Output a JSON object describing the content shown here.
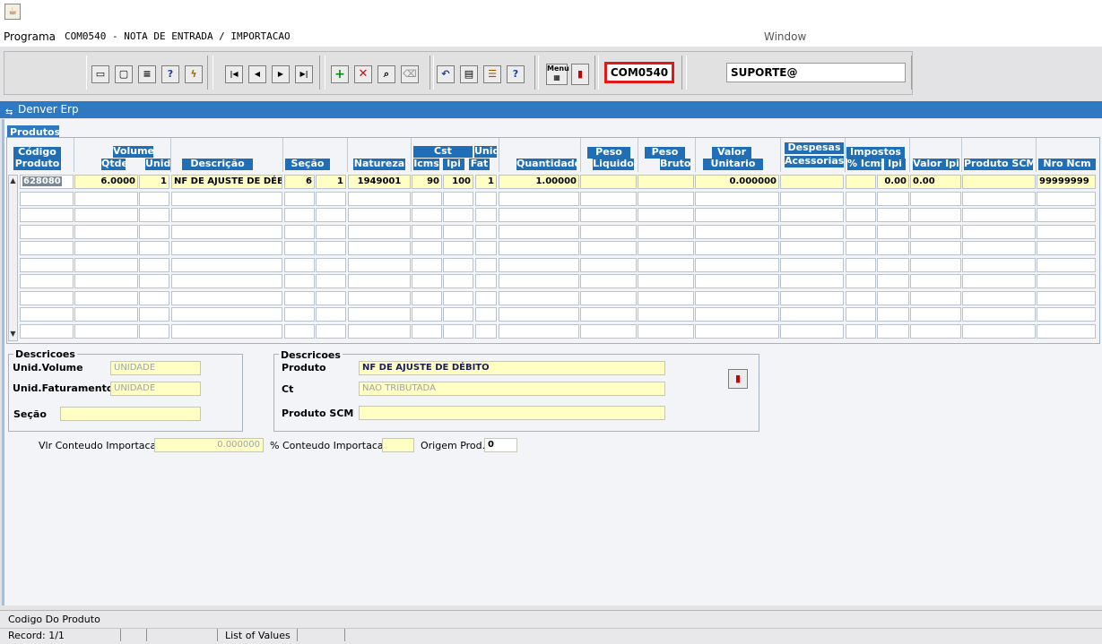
{
  "menubar": {
    "programa": "Programa",
    "form_title": "COM0540 - NOTA DE ENTRADA / IMPORTACAO",
    "window": "Window"
  },
  "toolbar": {
    "form_code": "COM0540",
    "user": "SUPORTE@",
    "icons": [
      "save-icon",
      "print-preview-icon",
      "print-icon",
      "help-query-icon",
      "execute-query-icon",
      "first-record-icon",
      "previous-record-icon",
      "next-record-icon",
      "last-record-icon",
      "insert-record-icon",
      "delete-record-icon",
      "query-icon",
      "clear-icon",
      "undo-icon",
      "copy-icon",
      "list-icon",
      "help-icon",
      "menu-icon",
      "exit-icon"
    ]
  },
  "window": {
    "title": "Denver Erp"
  },
  "tab": {
    "label": "Produtos"
  },
  "grid": {
    "headers": {
      "codigo": "Código",
      "produto": "Produto",
      "volume": "Volume",
      "qtde": "Qtde",
      "unid": "Unid.",
      "descricao": "Descrição",
      "secao": "Seção",
      "natureza": "Natureza",
      "cst": "Cst",
      "icms": "Icms",
      "ipi": "Ipi",
      "unid2": "Unid",
      "fat": "Fat",
      "quantidade": "Quantidade",
      "peso1": "Peso",
      "liquido": "Liquido",
      "peso2": "Peso",
      "bruto": "Bruto",
      "valor": "Valor",
      "unitario": "Unitario",
      "despesas": "Despesas",
      "acessorias": "Acessorias",
      "impostos": "Impostos",
      "pct_icms": "% Icms",
      "imp_ipi": "Ipi",
      "valor_ipi": "Valor Ipi",
      "produto_scm": "Produto SCM",
      "nro_ncm": "Nro Ncm"
    },
    "row1": {
      "codigo": "628080",
      "qtde": "6.0000",
      "unid": "1",
      "descricao": "NF DE AJUSTE DE DÉBITO",
      "secao1": "6",
      "secao2": "1",
      "natureza": "1949001",
      "cst_icms": "90",
      "cst_ipi": "100",
      "unid_fat": "1",
      "quantidade": "1.00000",
      "valor_unitario": "0.000000",
      "pct_icms": "",
      "ipi": "0.00",
      "valor_ipi": "0.00",
      "nro_ncm": "99999999"
    }
  },
  "descricoes_left": {
    "title": "Descricoes",
    "unid_volume_label": "Unid.Volume",
    "unid_volume_value": "UNIDADE",
    "unid_faturamento_label": "Unid.Faturamento",
    "unid_faturamento_value": "UNIDADE",
    "secao_label": "Seção",
    "secao_value": ""
  },
  "descricoes_right": {
    "title": "Descricoes",
    "produto_label": "Produto",
    "produto_value": "NF DE AJUSTE DE DÉBITO",
    "ct_label": "Ct",
    "ct_value": "NAO TRIBUTADA",
    "produto_scm_label": "Produto SCM",
    "produto_scm_value": ""
  },
  "importacao": {
    "vlr_label": "Vlr Conteudo Importacao:",
    "vlr_value": "0.000000",
    "pct_label": "% Conteudo Importacao:",
    "pct_value": "",
    "origem_label": "Origem Prod.",
    "origem_value": "0"
  },
  "status": {
    "hint": "Codigo Do Produto",
    "record": "Record: 1/1",
    "list_of_values": "List of Values"
  },
  "colors": {
    "accent_blue": "#1f6eb6",
    "field_yellow": "#ffffc4",
    "highlight_red": "#e01818"
  }
}
